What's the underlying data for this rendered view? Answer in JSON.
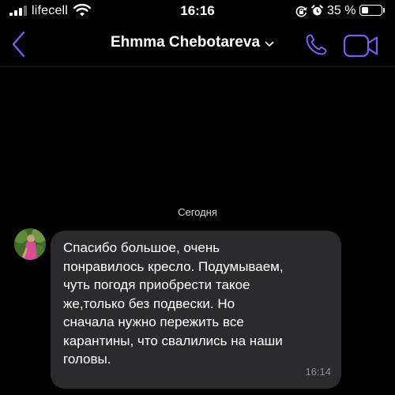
{
  "status_bar": {
    "carrier": "lifecell",
    "time": "16:16",
    "battery_percent": "35 %",
    "battery_level": 0.35,
    "icons": [
      "signal-icon",
      "wifi-icon",
      "rotation-lock-icon",
      "alarm-icon",
      "battery-icon"
    ]
  },
  "header": {
    "contact_name": "Ehmma Chebotareva",
    "icons": [
      "back-chevron-icon",
      "chevron-down-icon",
      "phone-icon",
      "video-camera-icon"
    ]
  },
  "colors": {
    "accent": "#7360f2",
    "background": "#000000",
    "bubble": "#2b2b2d",
    "timestamp": "#8e8e92"
  },
  "chat": {
    "date_separator": "Сегодня",
    "messages": [
      {
        "direction": "incoming",
        "text": "Спасибо большое, очень\nпонравилось кресло. Подумываем,\nчуть погодя приобрести такое\nже,только без подвески. Но\nсначала нужно пережить все\nкарантины, что свалились на наши\nголовы.",
        "time": "16:14"
      }
    ]
  }
}
